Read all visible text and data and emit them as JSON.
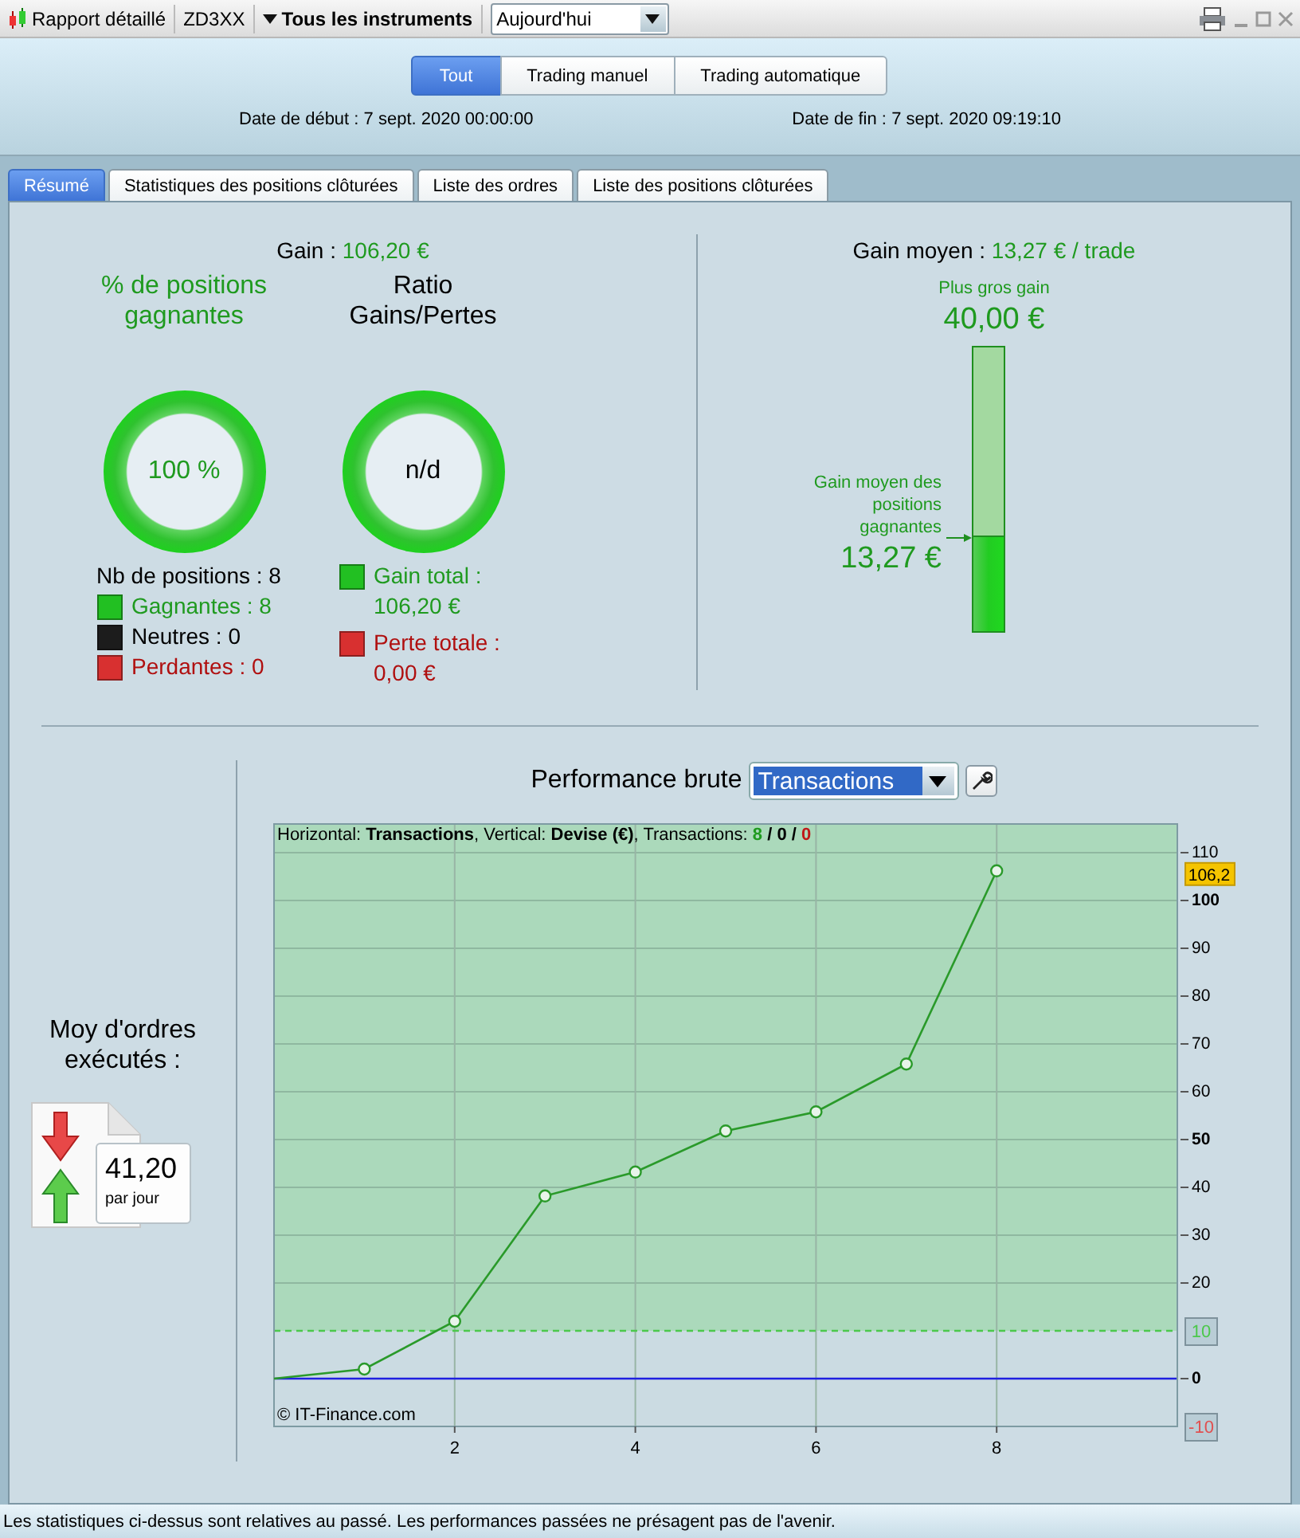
{
  "toolbar": {
    "items": [
      {
        "kind": "report",
        "label": "Rapport détaillé"
      },
      {
        "kind": "account",
        "label": "ZD3XX"
      },
      {
        "kind": "menu",
        "label": "Tous les instruments"
      }
    ],
    "period": {
      "value": "Aujourd'hui"
    }
  },
  "filters": [
    {
      "label": "Tout",
      "selected": true
    },
    {
      "label": "Trading manuel",
      "selected": false
    },
    {
      "label": "Trading automatique",
      "selected": false
    }
  ],
  "dates": [
    {
      "label": "Date de début :",
      "value": "7 sept. 2020 00:00:00"
    },
    {
      "label": "Date de fin :",
      "value": "7 sept. 2020 09:19:10"
    }
  ],
  "tabs": [
    {
      "label": "Résumé",
      "selected": true
    },
    {
      "label": "Statistiques des positions clôturées",
      "selected": false
    },
    {
      "label": "Liste des ordres",
      "selected": false
    },
    {
      "label": "Liste des positions clôturées",
      "selected": false
    }
  ],
  "summary": {
    "gain_label": "Gain :",
    "gain_value": "106,20 €",
    "gauges": [
      {
        "title": "% de positions gagnantes",
        "value": "100 %",
        "color": "#1f9a1f"
      },
      {
        "title": "Ratio Gains/Pertes",
        "value": "n/d",
        "color": "#000000"
      }
    ],
    "positions": {
      "label": "Nb de positions : 8",
      "rows": [
        {
          "label": "Gagnantes : 8",
          "color": "#22c022"
        },
        {
          "label": "Neutres : 0",
          "color": "#1c1c1c"
        },
        {
          "label": "Perdantes : 0",
          "color": "#d83030"
        }
      ]
    },
    "totals": [
      {
        "label": "Gain total :",
        "value": "106,20 €",
        "color": "#22c022"
      },
      {
        "label": "Perte totale :",
        "value": "0,00 €",
        "color": "#d83030"
      }
    ]
  },
  "average": {
    "label": "Gain moyen :",
    "value": "13,27 € / trade",
    "max_label": "Plus gros gain",
    "max_value": "40,00 €",
    "avg_label": "Gain moyen des positions gagnantes",
    "avg_value": "13,27 €",
    "level": 0.33
  },
  "orders": {
    "title": "Moy d'ordres exécutés :",
    "value": "41,20",
    "unit": "par jour"
  },
  "performance": {
    "title": "Performance brute",
    "mode": "Transactions",
    "caption": {
      "text": "Horizontal: **Transactions**, Vertical: **Devise (€)**, Transactions:",
      "separator": "/",
      "counts": [
        {
          "value": "8",
          "color": "#1f9a1f"
        },
        {
          "value": "0",
          "color": "#000000"
        },
        {
          "value": "0",
          "color": "#c01818"
        }
      ]
    },
    "copyright": "© IT-Finance.com",
    "chart_data": {
      "type": "line",
      "x": [
        0,
        1,
        2,
        3,
        4,
        5,
        6,
        7,
        8
      ],
      "series": [
        {
          "color": "#2a9a2a",
          "marker": "circle",
          "values": [
            0,
            2,
            12,
            38.2,
            43.2,
            51.8,
            55.8,
            65.8,
            106.2
          ]
        }
      ],
      "xlim": [
        0,
        10
      ],
      "ylim": [
        -10,
        116
      ],
      "xticks": [
        2,
        4,
        6,
        8
      ],
      "yticks": [
        0,
        20,
        30,
        40,
        50,
        60,
        70,
        80,
        90,
        100,
        110
      ],
      "grid": true,
      "bands": [
        {
          "axis": "y",
          "from": 10,
          "to": 116,
          "color": "#abd9bb"
        }
      ],
      "ref_lines": [
        {
          "axis": "y",
          "value": 10,
          "label": "10",
          "color": "#4cc84c"
        },
        {
          "axis": "y",
          "value": 0,
          "color": "#2020e0"
        }
      ],
      "annotations": [
        "-10",
        "106,2"
      ]
    }
  },
  "status_bar": "Les statistiques ci-dessus sont relatives au passé. Les performances passées ne présagent pas de l'avenir."
}
